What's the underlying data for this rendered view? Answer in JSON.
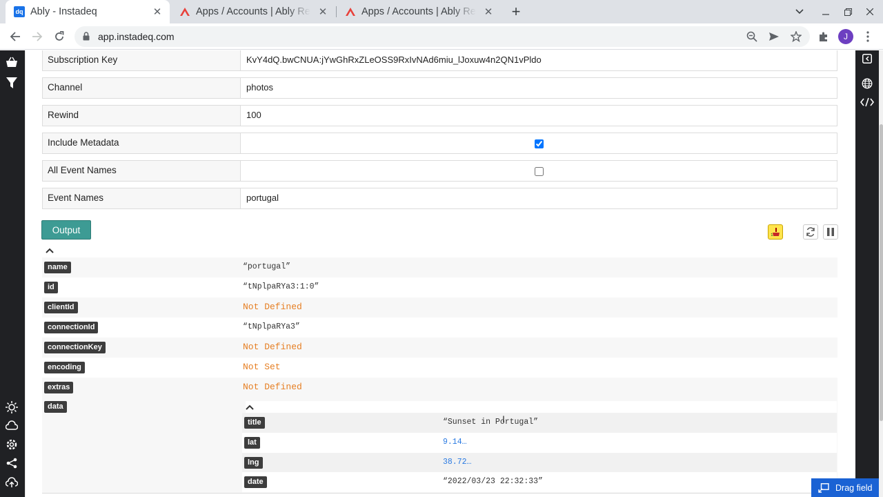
{
  "browser": {
    "tabs": [
      {
        "title": "Ably - Instadeq",
        "favicon": "dq",
        "active": true
      },
      {
        "title": "Apps / Accounts | Ably Re",
        "favicon": "ably-icon",
        "active": false
      },
      {
        "title": "Apps / Accounts | Ably Re",
        "favicon": "ably-icon",
        "active": false
      }
    ],
    "url": "app.instadeq.com",
    "profile_initial": "J"
  },
  "form": {
    "fields": [
      {
        "label": "Subscription Key",
        "value": "KvY4dQ.bwCNUA:jYwGhRxZLeOSS9RxIvNAd6miu_lJoxuw4n2QN1vPldo"
      },
      {
        "label": "Channel",
        "value": "photos"
      },
      {
        "label": "Rewind",
        "value": "100"
      },
      {
        "label": "Include Metadata",
        "checked": true
      },
      {
        "label": "All Event Names",
        "checked": false
      },
      {
        "label": "Event Names",
        "value": "portugal"
      }
    ]
  },
  "output": {
    "button_label": "Output",
    "rows": [
      {
        "key": "name",
        "value": "“portugal”"
      },
      {
        "key": "id",
        "value": "“tNplpaRYa3:1:0”"
      },
      {
        "key": "clientId",
        "value": "Not Defined"
      },
      {
        "key": "connectionId",
        "value": "“tNplpaRYa3”"
      },
      {
        "key": "connectionKey",
        "value": "Not Defined"
      },
      {
        "key": "encoding",
        "value": "Not Set"
      },
      {
        "key": "extras",
        "value": "Not Defined"
      },
      {
        "key": "data",
        "value": ""
      }
    ],
    "data_rows": [
      {
        "key": "title",
        "value": "“Sunset in Portugal”"
      },
      {
        "key": "lat",
        "value": "9.14…"
      },
      {
        "key": "lng",
        "value": "38.72…"
      },
      {
        "key": "date",
        "value": "“2022/03/23 22:32:33”"
      }
    ]
  },
  "drag_field_label": "Drag field",
  "colors": {
    "accent": "#3d9b94",
    "not_defined": "#e67e22",
    "number": "#2a7ae2",
    "drag": "#1a62d4"
  }
}
